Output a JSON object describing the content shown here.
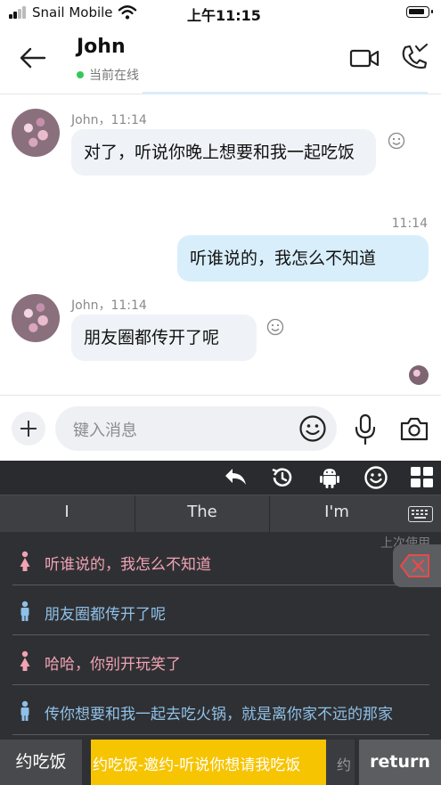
{
  "status_bar": {
    "carrier": "Snail Mobile",
    "time": "上午11:15"
  },
  "header": {
    "contact_name": "John",
    "presence": "当前在线"
  },
  "messages": [
    {
      "sender": "John",
      "time": "John，11:14",
      "text": "对了，听说你晚上想要和我一起吃饭"
    },
    {
      "time": "11:14",
      "text": "听谁说的，我怎么不知道"
    },
    {
      "sender": "John",
      "time": "John，11:14",
      "text": "朋友圈都传开了呢"
    }
  ],
  "compose": {
    "placeholder": "键入消息"
  },
  "keyboard": {
    "suggestions": [
      "I",
      "The",
      "I'm"
    ],
    "last_used_label": "上次使用",
    "phrases": [
      {
        "gender": "female",
        "text": "听谁说的，我怎么不知道"
      },
      {
        "gender": "male",
        "text": "朋友圈都传开了呢"
      },
      {
        "gender": "female",
        "text": "哈哈，你别开玩笑了"
      },
      {
        "gender": "male",
        "text": "传你想要和我一起去吃火锅，就是离你家不远的那家"
      }
    ],
    "category": "约吃饭",
    "category_strip": "约吃饭-邀约-听说你想请我吃饭",
    "category_next": "约",
    "return_label": "return"
  },
  "colors": {
    "online": "#35c759",
    "incoming_bubble": "#eff2f6",
    "outgoing_bubble": "#d8eefb",
    "female_text": "#f0a3b4",
    "male_text": "#8fc1e8",
    "category_highlight": "#f6c400"
  }
}
